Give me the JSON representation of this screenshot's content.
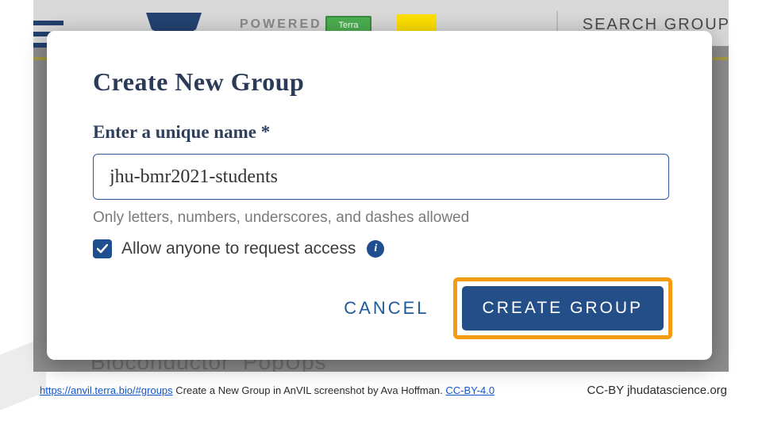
{
  "background": {
    "powered_label": "POWERED",
    "terra_badge": "Terra",
    "search_label": "SEARCH GROUP",
    "partial_text": "Bioconductor_PopUps"
  },
  "dialog": {
    "title": "Create New Group",
    "field_label": "Enter a unique name *",
    "input_value": "jhu-bmr2021-students",
    "hint": "Only letters, numbers, underscores, and dashes allowed",
    "checkbox_label": "Allow anyone to request access",
    "checkbox_checked": true,
    "cancel_label": "CANCEL",
    "create_label": "CREATE GROUP"
  },
  "footer": {
    "url_text": "https://anvil.terra.bio/#groups",
    "caption_mid": " Create a New Group in AnVIL screenshot by Ava Hoffman.  ",
    "license_link": "CC-BY-4.0",
    "right": "CC-BY  jhudatascience.org"
  }
}
